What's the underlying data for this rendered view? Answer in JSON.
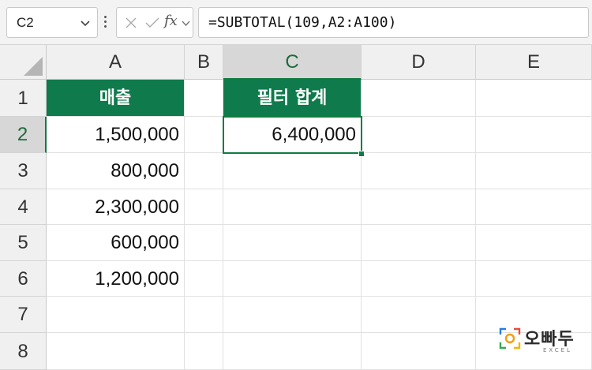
{
  "formula_bar": {
    "name_box": "C2",
    "fx_label": "fx",
    "formula": "=SUBTOTAL(109,A2:A100)"
  },
  "columns": [
    "A",
    "B",
    "C",
    "D",
    "E"
  ],
  "rows": [
    "1",
    "2",
    "3",
    "4",
    "5",
    "6",
    "7",
    "8"
  ],
  "cells": {
    "A1": "매출",
    "A2": "1,500,000",
    "A3": "800,000",
    "A4": "2,300,000",
    "A5": "600,000",
    "A6": "1,200,000",
    "C1": "필터 합계",
    "C2": "6,400,000"
  },
  "selection": {
    "active_cell": "C2"
  },
  "colors": {
    "header_fill": "#0f7a4c",
    "selection": "#107c41"
  },
  "watermark": {
    "name": "오빠두",
    "sub": "EXCEL"
  }
}
